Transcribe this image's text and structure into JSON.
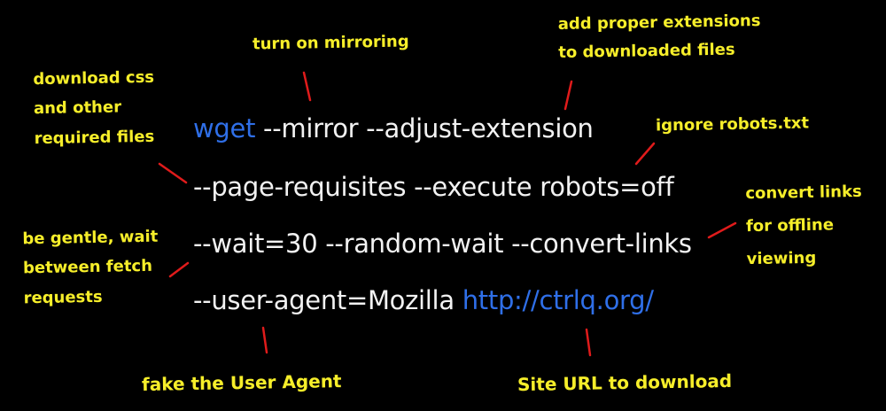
{
  "colors": {
    "background": "#000000",
    "command_text": "#f2f2f2",
    "command_accent": "#2f6fe8",
    "annotation_text": "#f6ee2a",
    "pointer_line": "#e01b1b"
  },
  "command": {
    "line1": {
      "program": "wget",
      "args": " --mirror --adjust-extension"
    },
    "line2": "--page-requisites --execute robots=off",
    "line3": "--wait=30 --random-wait --convert-links",
    "line4": {
      "args": "--user-agent=Mozilla ",
      "url": "http://ctrlq.org/"
    }
  },
  "annotations": {
    "mirroring": [
      "turn on mirroring"
    ],
    "extensions": [
      "add proper extensions",
      "to downloaded files"
    ],
    "css": [
      "download css",
      "and other",
      "required files"
    ],
    "robots": [
      "ignore robots.txt"
    ],
    "convert": [
      "convert links",
      "for offline",
      "viewing"
    ],
    "gentle": [
      "be gentle, wait",
      "between fetch",
      "requests"
    ],
    "user_agent": [
      "fake the User Agent"
    ],
    "site_url": [
      "Site URL to download"
    ]
  }
}
